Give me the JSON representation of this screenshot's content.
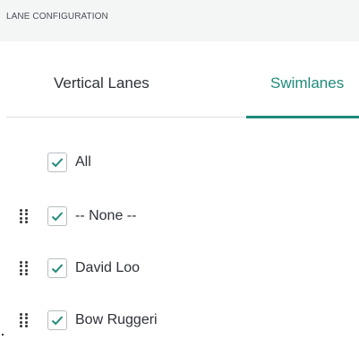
{
  "header": {
    "title": "LANE CONFIGURATION"
  },
  "tabs": [
    {
      "label": "Vertical Lanes",
      "active": false
    },
    {
      "label": "Swimlanes",
      "active": true
    }
  ],
  "lanes": [
    {
      "label": "All",
      "checked": true,
      "draggable": false
    },
    {
      "label": "-- None --",
      "checked": true,
      "draggable": true
    },
    {
      "label": "David Loo",
      "checked": true,
      "draggable": true
    },
    {
      "label": "Bow Ruggeri",
      "checked": true,
      "draggable": true
    }
  ],
  "colors": {
    "accent": "#1f8a7a",
    "header_bg": "#f4f5f5",
    "divider": "#dcdfe2"
  }
}
